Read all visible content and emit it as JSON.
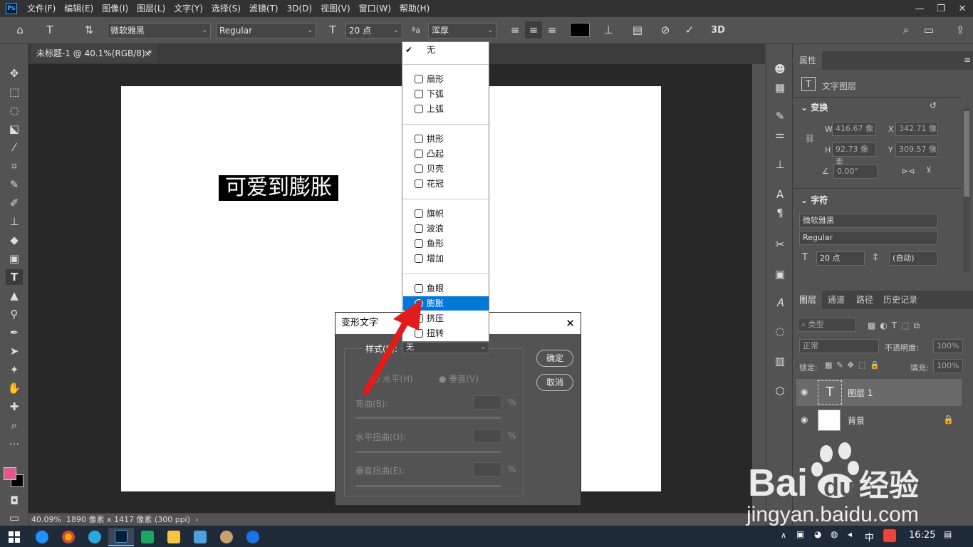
{
  "menubar": {
    "logo": "Ps",
    "items": [
      "文件(F)",
      "编辑(E)",
      "图像(I)",
      "图层(L)",
      "文字(Y)",
      "选择(S)",
      "滤镜(T)",
      "3D(D)",
      "视图(V)",
      "窗口(W)",
      "帮助(H)"
    ]
  },
  "options": {
    "font_family": "微软雅黑",
    "font_style": "Regular",
    "font_size": "20 点",
    "aa_method": "浑厚",
    "aa_icon": "ªa"
  },
  "document": {
    "tab_title": "未标题-1 @ 40.1%(RGB/8) *",
    "canvas_text": "可爱到膨胀"
  },
  "status": {
    "zoom": "40.09%",
    "info": "1890 像素 x 1417 像素 (300 ppi)"
  },
  "properties": {
    "tab": "属性",
    "layer_type": "文字图层",
    "transform": "变换",
    "w_label": "W",
    "w_value": "416.67 像",
    "x_label": "X",
    "x_value": "342.71 像",
    "h_label": "H",
    "h_value": "92.73 像素",
    "y_label": "Y",
    "y_value": "309.57 像",
    "angle": "0.00°",
    "character": "字符",
    "font_family": "微软雅黑",
    "font_style": "Regular",
    "font_size": "20 点",
    "leading": "(自动)"
  },
  "layers": {
    "tabs": [
      "图层",
      "通道",
      "路径",
      "历史记录"
    ],
    "filter": "类型",
    "blend": "正常",
    "opacity_label": "不透明度:",
    "opacity": "100%",
    "lock_label": "锁定:",
    "fill_label": "填充:",
    "fill": "100%",
    "items": [
      {
        "name": "图层 1",
        "type": "text"
      },
      {
        "name": "背景",
        "type": "bg"
      }
    ]
  },
  "dialog": {
    "title": "变形文字",
    "style_label": "样式(S):",
    "style_value": "无",
    "ok": "确定",
    "cancel": "取消",
    "horizontal": "水平(H)",
    "vertical": "垂直(V)",
    "bend": "弯曲(B):",
    "h_distort": "水平扭曲(O):",
    "v_distort": "垂直扭曲(E):",
    "pct": "%"
  },
  "style_menu": {
    "none": "无",
    "groups": [
      [
        "扇形",
        "下弧",
        "上弧"
      ],
      [
        "拱形",
        "凸起",
        "贝壳",
        "花冠"
      ],
      [
        "旗帜",
        "波浪",
        "鱼形",
        "增加"
      ],
      [
        "鱼眼",
        "膨胀",
        "挤压",
        "扭转"
      ]
    ],
    "selected": "膨胀"
  },
  "taskbar": {
    "time": "16:25",
    "ime": "中"
  },
  "watermark": {
    "brand": "Bai",
    "brand_du": "du",
    "brand_cn": "经验",
    "url": "jingyan.baidu.com"
  },
  "colors": {
    "foreground": "#e0578f",
    "background": "#000000",
    "accent": "#0078d7",
    "arrow": "#e31b1b"
  }
}
